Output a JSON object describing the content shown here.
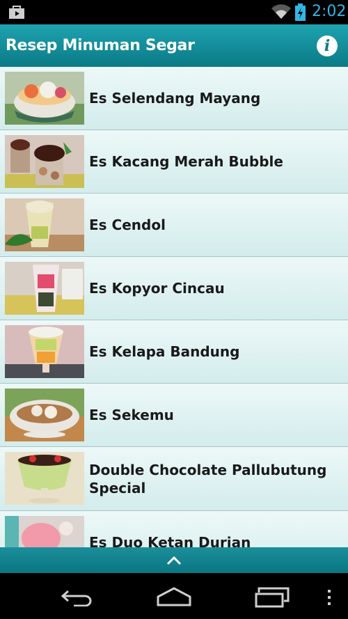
{
  "status_bar": {
    "time": "2:02"
  },
  "action_bar": {
    "title": "Resep Minuman Segar",
    "info_label": "i"
  },
  "recipes": [
    {
      "name": "Es Selendang Mayang"
    },
    {
      "name": "Es Kacang Merah Bubble"
    },
    {
      "name": "Es Cendol"
    },
    {
      "name": "Es Kopyor Cincau"
    },
    {
      "name": "Es Kelapa Bandung"
    },
    {
      "name": "Es Sekemu"
    },
    {
      "name": "Double Chocolate Pallubutung Special"
    },
    {
      "name": "Es Duo Ketan Durian"
    }
  ],
  "icons": {
    "status_left": "shopping-bag-icon",
    "wifi": "wifi-icon",
    "battery": "battery-charging-icon",
    "info": "info-icon",
    "expand": "chevron-up-icon",
    "nav_back": "back-icon",
    "nav_home": "home-icon",
    "nav_recents": "recents-icon",
    "nav_menu": "overflow-menu-icon"
  },
  "colors": {
    "accent": "#33b5e5",
    "action_bar": "#0a7a86",
    "list_bg": "#e2f2f3"
  }
}
